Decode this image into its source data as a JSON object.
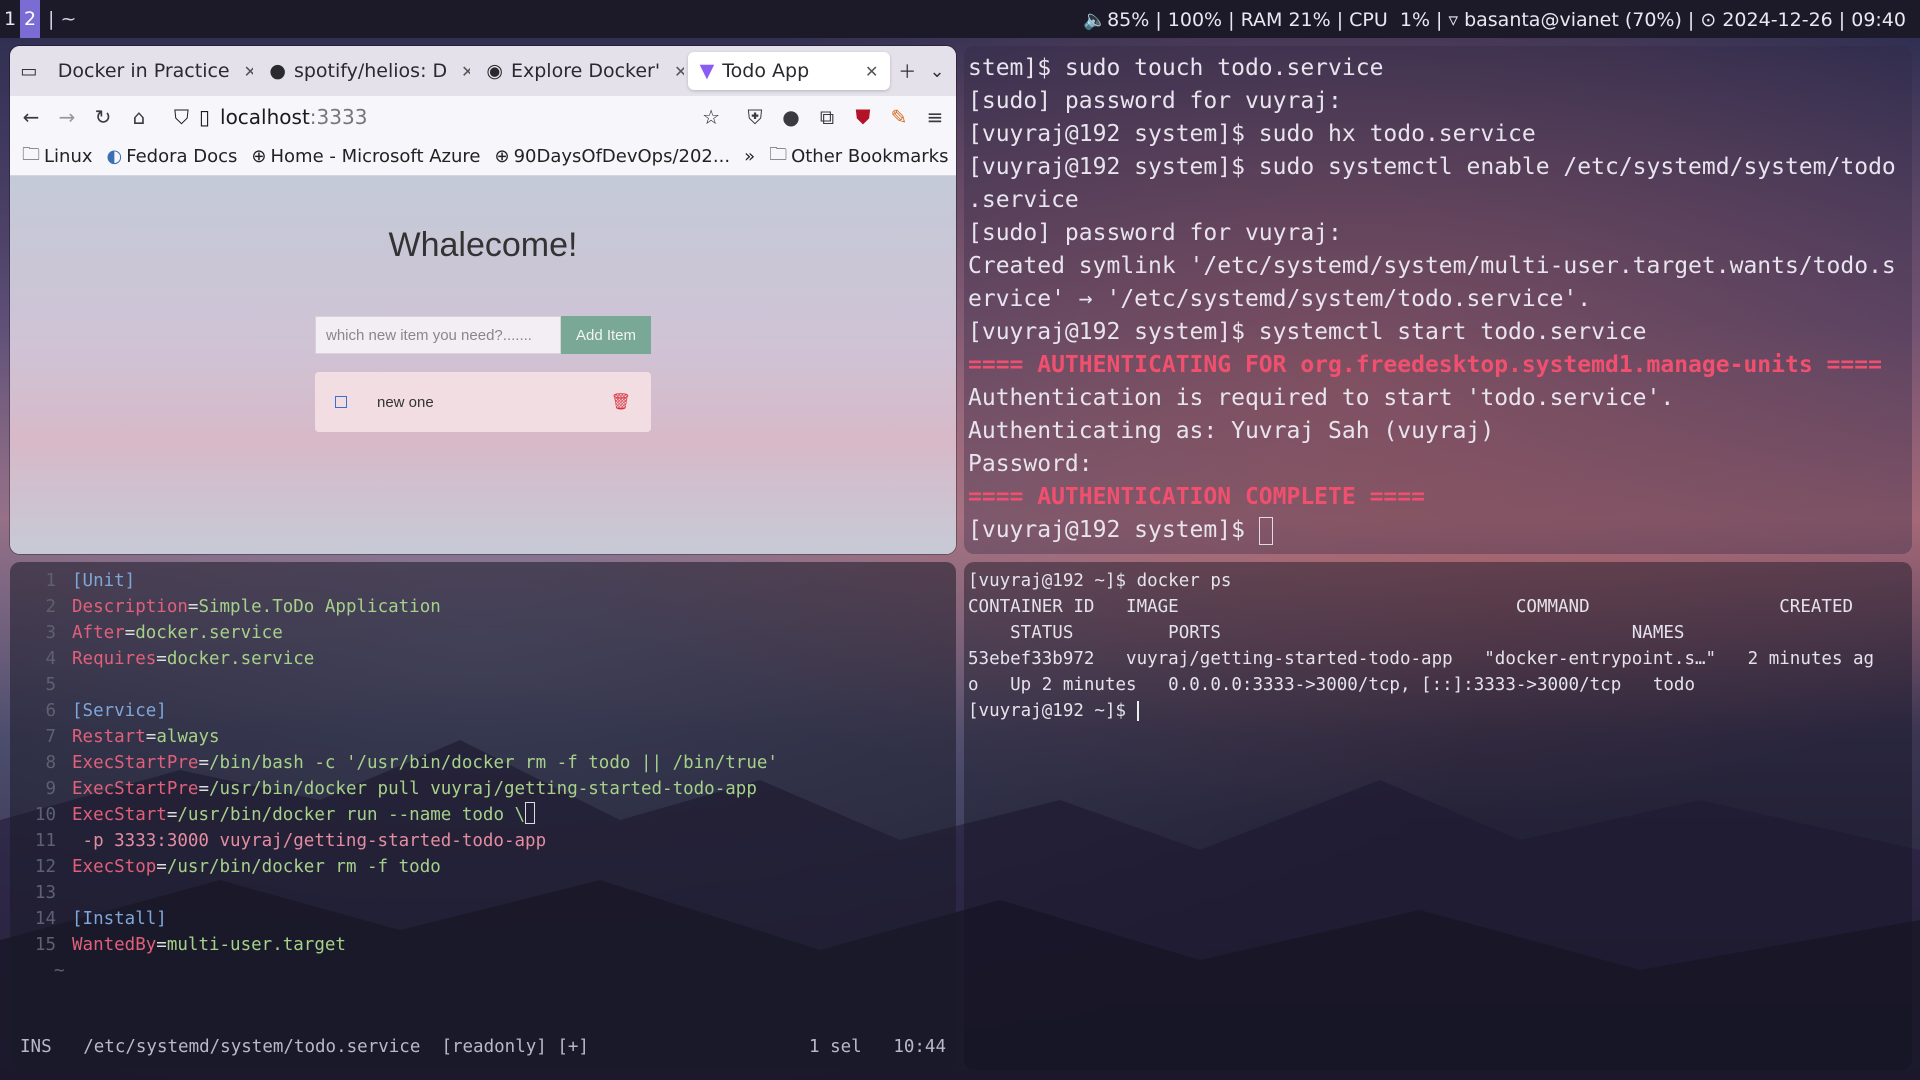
{
  "topbar": {
    "workspaces": [
      "1",
      "2"
    ],
    "window_title": "| ~",
    "status": "🔈85% | 100% | RAM 21% | CPU  1% | ▿ basanta@vianet (70%) | ⊙ 2024-12-26 | 09:40"
  },
  "browser": {
    "tabs": [
      {
        "label": "Docker in Practice",
        "icon": "doc-icon"
      },
      {
        "label": "spotify/helios: D",
        "icon": "github-icon"
      },
      {
        "label": "Explore Docker'",
        "icon": "docker-icon"
      },
      {
        "label": "Todo App",
        "icon": "vite-icon"
      }
    ],
    "url_host": "localhost",
    "url_port": ":3333",
    "bookmarks": [
      "Linux",
      "Fedora Docs",
      "Home - Microsoft Azure",
      "90DaysOfDevOps/202...",
      "Other Bookmarks"
    ],
    "page": {
      "heading": "Whalecome!",
      "input_placeholder": "which new item you need?.......",
      "add_button": "Add Item",
      "items": [
        {
          "text": "new one",
          "checked": false
        }
      ]
    }
  },
  "terminal_top": {
    "lines": [
      {
        "t": "stem]$ sudo touch todo.service"
      },
      {
        "t": "[sudo] password for vuyraj:"
      },
      {
        "t": "[vuyraj@192 system]$ sudo hx todo.service"
      },
      {
        "t": "[vuyraj@192 system]$ sudo systemctl enable /etc/systemd/system/todo"
      },
      {
        "t": ".service"
      },
      {
        "t": "[sudo] password for vuyraj:"
      },
      {
        "t": "Created symlink '/etc/systemd/system/multi-user.target.wants/todo.s"
      },
      {
        "t": "ervice' → '/etc/systemd/system/todo.service'."
      },
      {
        "t": "[vuyraj@192 system]$ systemctl start todo.service"
      },
      {
        "t": "==== AUTHENTICATING FOR org.freedesktop.systemd1.manage-units ====",
        "auth": true
      },
      {
        "t": "Authentication is required to start 'todo.service'."
      },
      {
        "t": "Authenticating as: Yuvraj Sah (vuyraj)"
      },
      {
        "t": "Password:"
      },
      {
        "t": "==== AUTHENTICATION COMPLETE ====",
        "auth": true
      }
    ],
    "prompt": "[vuyraj@192 system]$ "
  },
  "terminal_bottom": {
    "lines": [
      "[vuyraj@192 ~]$ docker ps",
      "CONTAINER ID   IMAGE                                COMMAND                  CREATED",
      "    STATUS         PORTS                                       NAMES",
      "53ebef33b972   vuyraj/getting-started-todo-app   \"docker-entrypoint.s…\"   2 minutes ag",
      "o   Up 2 minutes   0.0.0.0:3333->3000/tcp, [::]:3333->3000/tcp   todo"
    ],
    "prompt": "[vuyraj@192 ~]$ "
  },
  "editor": {
    "lines": [
      {
        "n": "1",
        "parts": [
          {
            "c": "kh",
            "t": "[Unit]"
          }
        ]
      },
      {
        "n": "2",
        "parts": [
          {
            "c": "kk",
            "t": "Description"
          },
          {
            "c": "",
            "t": "="
          },
          {
            "c": "kv",
            "t": "Simple.ToDo Application"
          }
        ]
      },
      {
        "n": "3",
        "parts": [
          {
            "c": "kk",
            "t": "After"
          },
          {
            "c": "",
            "t": "="
          },
          {
            "c": "kv",
            "t": "docker.service"
          }
        ]
      },
      {
        "n": "4",
        "parts": [
          {
            "c": "kk",
            "t": "Requires"
          },
          {
            "c": "",
            "t": "="
          },
          {
            "c": "kv",
            "t": "docker.service"
          }
        ]
      },
      {
        "n": "5",
        "parts": []
      },
      {
        "n": "6",
        "parts": [
          {
            "c": "kh",
            "t": "[Service]"
          }
        ]
      },
      {
        "n": "7",
        "parts": [
          {
            "c": "kk",
            "t": "Restart"
          },
          {
            "c": "",
            "t": "="
          },
          {
            "c": "kv",
            "t": "always"
          }
        ]
      },
      {
        "n": "8",
        "parts": [
          {
            "c": "kk",
            "t": "ExecStartPre"
          },
          {
            "c": "",
            "t": "="
          },
          {
            "c": "kv",
            "t": "/bin/bash -c '/usr/bin/docker rm -f todo || /bin/true'"
          }
        ]
      },
      {
        "n": "9",
        "parts": [
          {
            "c": "kk",
            "t": "ExecStartPre"
          },
          {
            "c": "",
            "t": "="
          },
          {
            "c": "kv",
            "t": "/usr/bin/docker pull vuyraj/getting-started-todo-app"
          }
        ]
      },
      {
        "n": "10",
        "parts": [
          {
            "c": "kk",
            "t": "ExecStart"
          },
          {
            "c": "",
            "t": "="
          },
          {
            "c": "kv",
            "t": "/usr/bin/docker run --name todo \\"
          }
        ]
      },
      {
        "n": "11",
        "parts": [
          {
            "c": "kr",
            "t": " -p 3333:3000 vuyraj/getting-started-todo-app"
          }
        ]
      },
      {
        "n": "12",
        "parts": [
          {
            "c": "kk",
            "t": "ExecStop"
          },
          {
            "c": "",
            "t": "="
          },
          {
            "c": "kv",
            "t": "/usr/bin/docker rm -f todo"
          }
        ]
      },
      {
        "n": "13",
        "parts": []
      },
      {
        "n": "14",
        "parts": [
          {
            "c": "kh",
            "t": "[Install]"
          }
        ]
      },
      {
        "n": "15",
        "parts": [
          {
            "c": "kk",
            "t": "WantedBy"
          },
          {
            "c": "",
            "t": "="
          },
          {
            "c": "kv",
            "t": "multi-user.target"
          }
        ]
      }
    ],
    "tilde": "~",
    "status_mode": "INS",
    "status_file": "/etc/systemd/system/todo.service  [readonly] [+]",
    "status_sel": "1 sel",
    "status_pos": "10:44"
  }
}
